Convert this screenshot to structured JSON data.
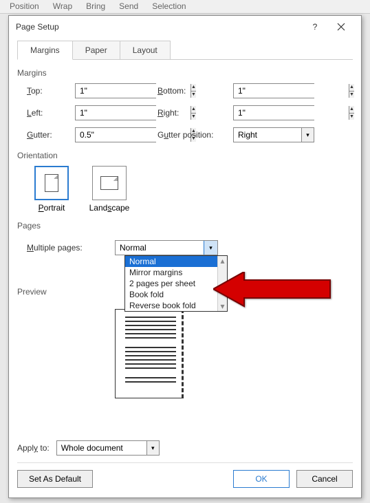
{
  "ribbon": {
    "items": [
      "Position",
      "Wrap",
      "Bring",
      "Send",
      "Selection"
    ]
  },
  "dialog": {
    "title": "Page Setup",
    "tabs": {
      "margins": "Margins",
      "paper": "Paper",
      "layout": "Layout"
    },
    "margins": {
      "heading": "Margins",
      "top_label": "Top:",
      "top_value": "1\"",
      "bottom_label": "Bottom:",
      "bottom_value": "1\"",
      "left_label": "Left:",
      "left_value": "1\"",
      "right_label": "Right:",
      "right_value": "1\"",
      "gutter_label": "Gutter:",
      "gutter_value": "0.5\"",
      "gutter_pos_label": "Gutter position:",
      "gutter_pos_value": "Right"
    },
    "orientation": {
      "heading": "Orientation",
      "portrait": "Portrait",
      "landscape": "Landscape"
    },
    "pages": {
      "heading": "Pages",
      "multiple_label": "Multiple pages:",
      "selected": "Normal",
      "options": [
        "Normal",
        "Mirror margins",
        "2 pages per sheet",
        "Book fold",
        "Reverse book fold"
      ]
    },
    "preview": {
      "heading": "Preview"
    },
    "apply": {
      "label": "Apply to:",
      "value": "Whole document"
    },
    "buttons": {
      "default": "Set As Default",
      "ok": "OK",
      "cancel": "Cancel"
    }
  }
}
